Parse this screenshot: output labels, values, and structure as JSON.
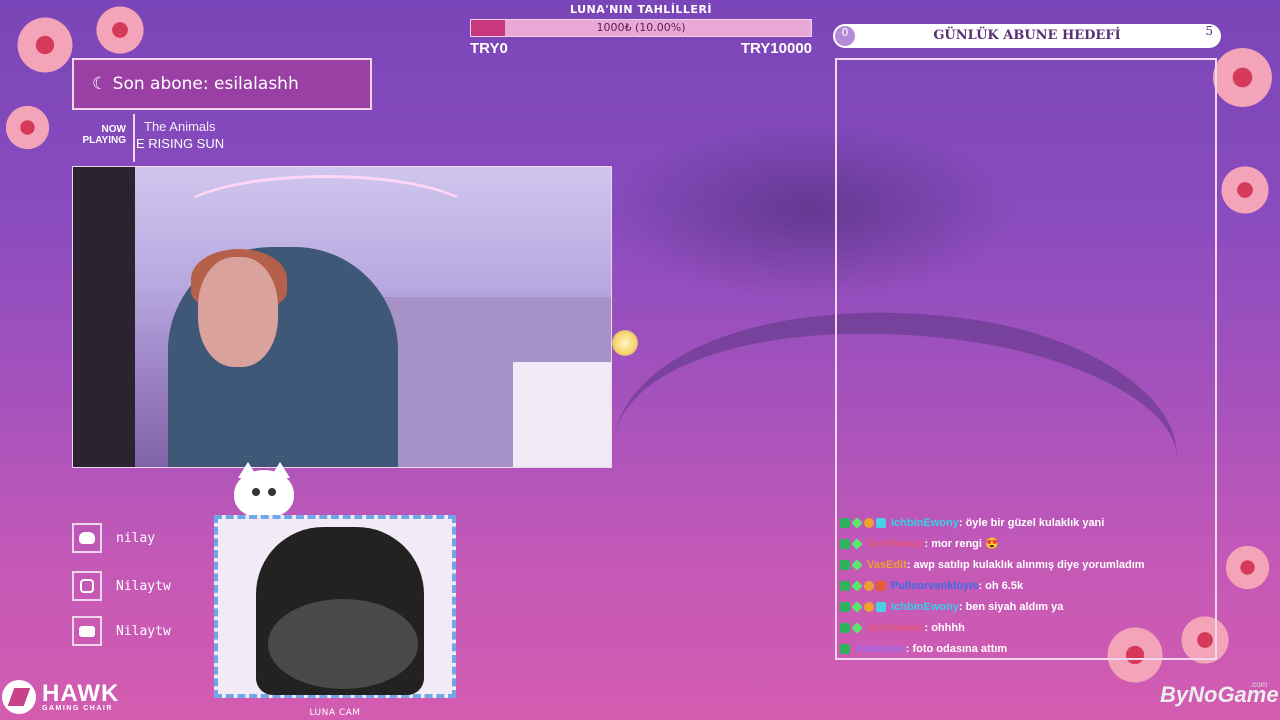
{
  "goal": {
    "title": "LUNA'NIN TAHLİLLERİ",
    "progress_text": "1000₺ (10.00%)",
    "progress_fraction": 0.1,
    "start": "TRY0",
    "end": "TRY10000"
  },
  "subgoal": {
    "label": "GÜNLÜK ABUNE HEDEFİ",
    "current": "0",
    "target": "5"
  },
  "last_sub": {
    "text": "Son abone: esilalashh"
  },
  "now_playing": {
    "label_line1": "NOW",
    "label_line2": "PLAYING",
    "artist": "The Animals",
    "title": "E RISING SUN"
  },
  "socials": [
    {
      "icon": "discord-icon",
      "handle": "nilay"
    },
    {
      "icon": "instagram-icon",
      "handle": "Nilaytw"
    },
    {
      "icon": "youtube-icon",
      "handle": "Nilaytw"
    }
  ],
  "luna_cam": {
    "label": "LUNA CAM"
  },
  "chat": [
    {
      "user": "IchbinEwony",
      "user_color": "#36d0e6",
      "badges": [
        "k",
        "plus",
        "coin",
        "cube"
      ],
      "message": ": öyle bir güzel kulaklık yani"
    },
    {
      "user": "farsthewac",
      "user_color": "#e2557a",
      "badges": [
        "k",
        "plus"
      ],
      "message": ": mor rengi 😍"
    },
    {
      "user": "VasEdit",
      "user_color": "#f0a030",
      "badges": [
        "k",
        "plus"
      ],
      "message": ": awp satılıp kulaklık alınmış diye yorumladım"
    },
    {
      "user": "Pullsorvenkloyis",
      "user_color": "#3a6be8",
      "badges": [
        "k",
        "plus",
        "coin",
        "crown"
      ],
      "message": ": oh 6.5k"
    },
    {
      "user": "IchbinEwony",
      "user_color": "#36d0e6",
      "badges": [
        "k",
        "plus",
        "coin",
        "cube"
      ],
      "message": ": ben siyah aldım ya"
    },
    {
      "user": "farsthewac",
      "user_color": "#e2557a",
      "badges": [
        "k",
        "plus"
      ],
      "message": ": ohhhh"
    },
    {
      "user": "Valianoys",
      "user_color": "#9b6ef0",
      "badges": [
        "k"
      ],
      "message": ": foto odasına attım"
    }
  ],
  "logos": {
    "hawk_big": "HAWK",
    "hawk_small": "GAMING CHAIR",
    "bynogame": "ByNoGame",
    "bynogame_com": ".com"
  },
  "colors": {
    "bg_top": "#7a45b8",
    "bg_bottom": "#d35cb0",
    "goal_fill": "#c9387c",
    "frame": "#f2d6f0"
  }
}
